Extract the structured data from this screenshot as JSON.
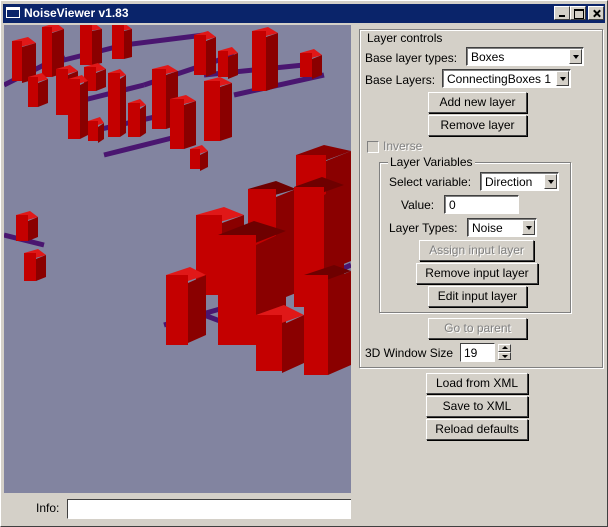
{
  "window": {
    "title": "NoiseViewer v1.83"
  },
  "info": {
    "label": "Info:",
    "value": ""
  },
  "layer_controls": {
    "title": "Layer controls",
    "base_layer_types_label": "Base layer types:",
    "base_layer_types_value": "Boxes",
    "base_layers_label": "Base Layers:",
    "base_layers_value": "ConnectingBoxes 1",
    "add_new_layer": "Add new layer",
    "remove_layer": "Remove layer",
    "inverse_label": "Inverse",
    "inverse_checked": false,
    "layer_variables": {
      "title": "Layer Variables",
      "select_variable_label": "Select variable:",
      "select_variable_value": "Direction",
      "value_label": "Value:",
      "value_value": "0",
      "layer_types_label": "Layer Types:",
      "layer_types_value": "Noise",
      "assign_input_layer": "Assign input layer",
      "remove_input_layer": "Remove input layer",
      "edit_input_layer": "Edit input layer"
    },
    "go_to_parent": "Go to parent",
    "window_size_label": "3D Window Size",
    "window_size_value": "19"
  },
  "actions": {
    "load_from_xml": "Load from XML",
    "save_to_xml": "Save to XML",
    "reload_defaults": "Reload defaults"
  },
  "colors": {
    "titlebar": "#0a246a",
    "viewport_background": "#8284a0",
    "box_front": "#c40000",
    "box_side": "#8a0000",
    "box_top": "#e01818",
    "connector": "#4a1670"
  },
  "icons": [
    "app-window-icon",
    "minimize-icon",
    "maximize-icon",
    "close-icon",
    "dropdown-arrow-icon",
    "spin-up-icon",
    "spin-down-icon"
  ]
}
